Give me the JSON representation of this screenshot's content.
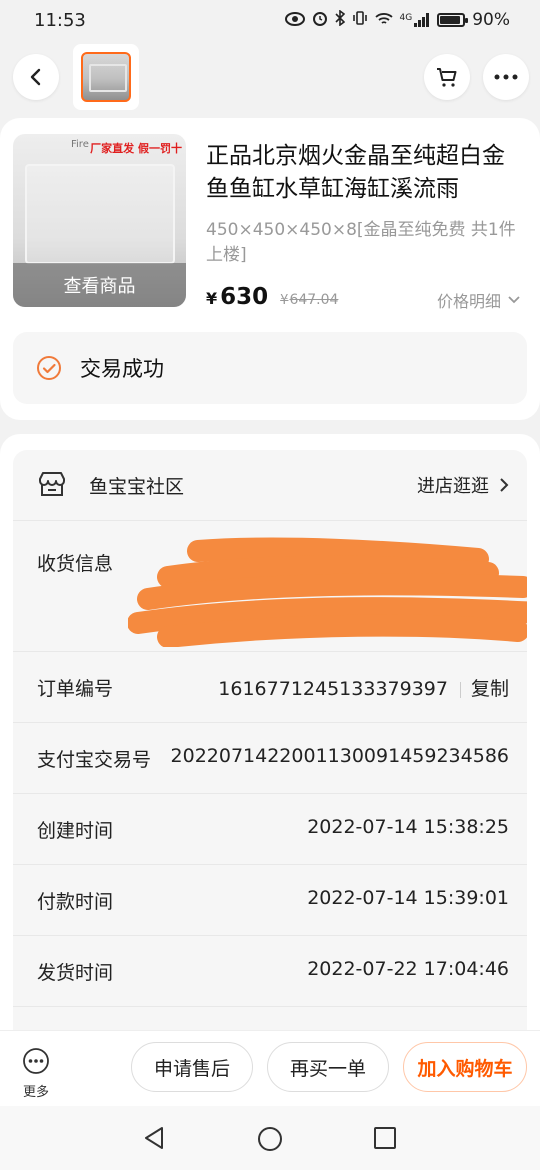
{
  "status_bar": {
    "time": "11:53",
    "network": "4G",
    "battery": "90%"
  },
  "product": {
    "title": "正品北京烟火金晶至纯超白金鱼鱼缸水草缸海缸溪流雨",
    "spec": "450×450×450×8[金晶至纯免费 共1件上楼]",
    "image_overlay_label": "查看商品",
    "image_tag_text": "厂家直发 假一罚十",
    "image_logo_text": "Fire",
    "price_symbol": "¥",
    "price": "630",
    "original_price_symbol": "¥",
    "original_price": "647.04",
    "price_detail_label": "价格明细"
  },
  "order_status": {
    "text": "交易成功"
  },
  "shop": {
    "name": "鱼宝宝社区",
    "enter_label": "进店逛逛"
  },
  "order_info": {
    "receive_label": "收货信息",
    "rows": [
      {
        "label": "订单编号",
        "value": "1616771245133379397",
        "action": "复制"
      },
      {
        "label": "支付宝交易号",
        "value": "2022071422001130091459234586"
      },
      {
        "label": "创建时间",
        "value": "2022-07-14 15:38:25"
      },
      {
        "label": "付款时间",
        "value": "2022-07-14 15:39:01"
      },
      {
        "label": "发货时间",
        "value": "2022-07-22 17:04:46"
      }
    ]
  },
  "actions": {
    "more_label": "更多",
    "after_sale": "申请售后",
    "rebuy": "再买一单",
    "add_to_cart": "加入购物车"
  },
  "colors": {
    "accent": "#ff5a00",
    "status_icon": "#f07a3a",
    "redaction": "#f58a3f"
  }
}
